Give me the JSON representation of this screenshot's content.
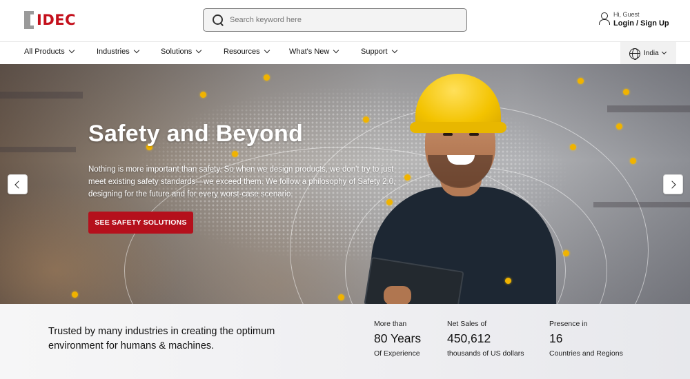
{
  "header": {
    "logo_text": "IDEC",
    "search_placeholder": "Search keyword here",
    "greeting": "Hi, Guest",
    "login_label": "Login / Sign Up"
  },
  "nav": {
    "items": [
      {
        "label": "All Products"
      },
      {
        "label": "Industries"
      },
      {
        "label": "Solutions"
      },
      {
        "label": "Resources"
      },
      {
        "label": "What's New"
      },
      {
        "label": "Support"
      }
    ],
    "region": "India",
    "region_icon": "globe-icon"
  },
  "hero": {
    "title": "Safety and Beyond",
    "description": "Nothing is more important than safety. So when we design products, we don't try to just meet existing safety standards—we exceed them. We follow a philosophy of Safety 2.0, designing for the future and for every worst-case scenario.",
    "cta_label": "SEE SAFETY SOLUTIONS",
    "accent_color": "#b5101c",
    "node_color": "#f0b300"
  },
  "stats": {
    "tagline": "Trusted by many industries in creating the optimum environment for humans & machines.",
    "items": [
      {
        "pre": "More than",
        "value": "80 Years",
        "post": "Of Experience"
      },
      {
        "pre": "Net Sales of",
        "value": "450,612",
        "post": "thousands of US dollars"
      },
      {
        "pre": "Presence in",
        "value": "16",
        "post": "Countries and Regions"
      }
    ]
  }
}
